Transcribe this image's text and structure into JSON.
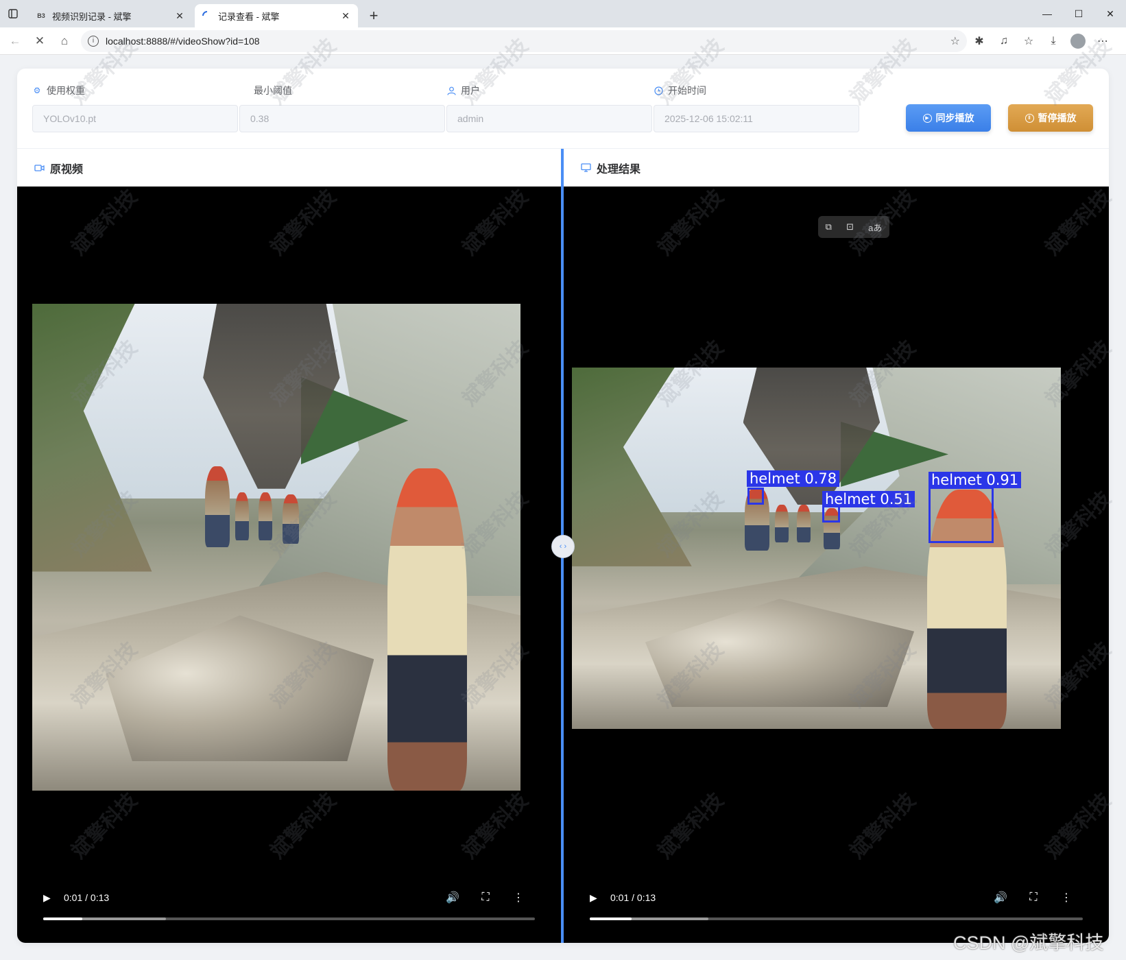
{
  "browser": {
    "tabs": [
      {
        "favicon": "B3",
        "title": "视频识别记录 - 斌擎",
        "active": false
      },
      {
        "favicon": "",
        "title": "记录查看 - 斌擎",
        "active": true
      }
    ],
    "url": "localhost:8888/#/videoShow?id=108"
  },
  "filters": {
    "weight": {
      "label": "使用权重",
      "value": "YOLOv10.pt",
      "icon": "cpu-icon"
    },
    "threshold": {
      "label": "最小阈值",
      "value": "0.38"
    },
    "user": {
      "label": "用户",
      "value": "admin",
      "icon": "user-icon"
    },
    "start_time": {
      "label": "开始时间",
      "value": "2025-12-06 15:02:11",
      "icon": "clock-icon"
    }
  },
  "buttons": {
    "sync_play": "同步播放",
    "pause_play": "暂停播放",
    "sync_color": "#4a8ef5",
    "pause_color": "#d99a40"
  },
  "panels": {
    "original": {
      "title": "原视频",
      "icon": "video-camera-icon",
      "time": "0:01 / 0:13",
      "progress": 0.08,
      "buffered": 0.25
    },
    "result": {
      "title": "处理结果",
      "icon": "monitor-icon",
      "time": "0:01 / 0:13",
      "progress": 0.085,
      "buffered": 0.24
    }
  },
  "detections": [
    {
      "label": "helmet 0.78"
    },
    {
      "label": "helmet 0.51"
    },
    {
      "label": "helmet 0.91"
    }
  ],
  "watermark": "斌擎科技",
  "footer_watermark": "CSDN @斌擎科技",
  "accent_color": "#4a8ef5",
  "box_color": "#2b36e8"
}
